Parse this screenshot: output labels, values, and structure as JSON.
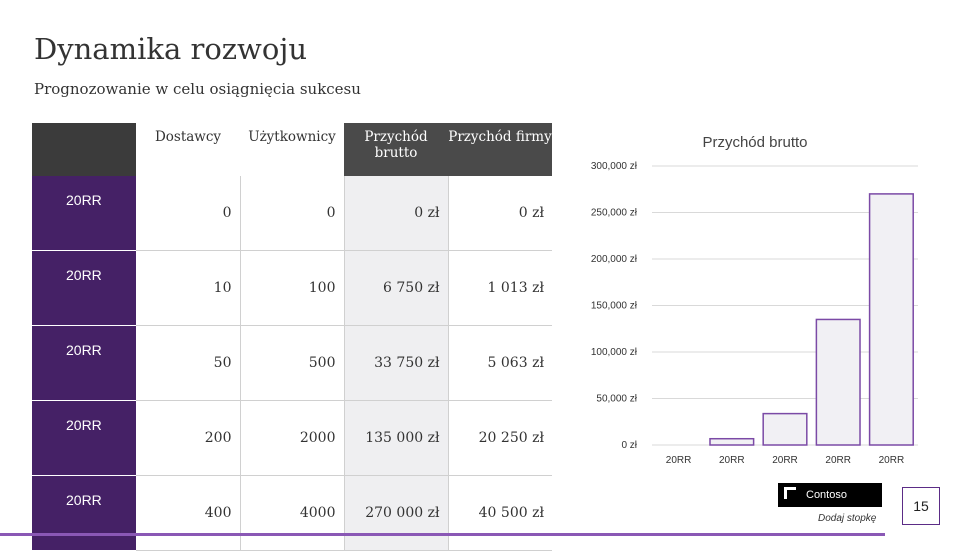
{
  "slide": {
    "title": "Dynamika rozwoju",
    "subtitle": "Prognozowanie w celu osiągnięcia sukcesu",
    "footer": "Dodaj stopkę",
    "page_number": "15",
    "logo_text": "Contoso"
  },
  "table": {
    "headers": [
      "Dostawcy",
      "Użytkownicy",
      "Przychód brutto",
      "Przychód firmy"
    ],
    "rows": [
      {
        "label": "20RR",
        "cells": [
          "0",
          "0",
          "0 zł",
          "0 zł"
        ]
      },
      {
        "label": "20RR",
        "cells": [
          "10",
          "100",
          "6 750 zł",
          "1 013 zł"
        ]
      },
      {
        "label": "20RR",
        "cells": [
          "50",
          "500",
          "33 750 zł",
          "5 063 zł"
        ]
      },
      {
        "label": "20RR",
        "cells": [
          "200",
          "2000",
          "135 000 zł",
          "20 250 zł"
        ]
      },
      {
        "label": "20RR",
        "cells": [
          "400",
          "4000",
          "270 000 zł",
          "40 500 zł"
        ]
      }
    ]
  },
  "chart_data": {
    "type": "bar",
    "title": "Przychód brutto",
    "categories": [
      "20RR",
      "20RR",
      "20RR",
      "20RR",
      "20RR"
    ],
    "values": [
      0,
      6750,
      33750,
      135000,
      270000
    ],
    "ylim": [
      0,
      300000
    ],
    "ytick_labels": [
      "0 zł",
      "50,000 zł",
      "100,000 zł",
      "150,000 zł",
      "200,000 zł",
      "250,000 zł",
      "300,000 zł"
    ],
    "grid": true,
    "bar_fill": "#f1f0f4",
    "bar_stroke": "#7b4aa6"
  },
  "colors": {
    "accent": "#452166",
    "header_dark": "#3b3b3b"
  }
}
